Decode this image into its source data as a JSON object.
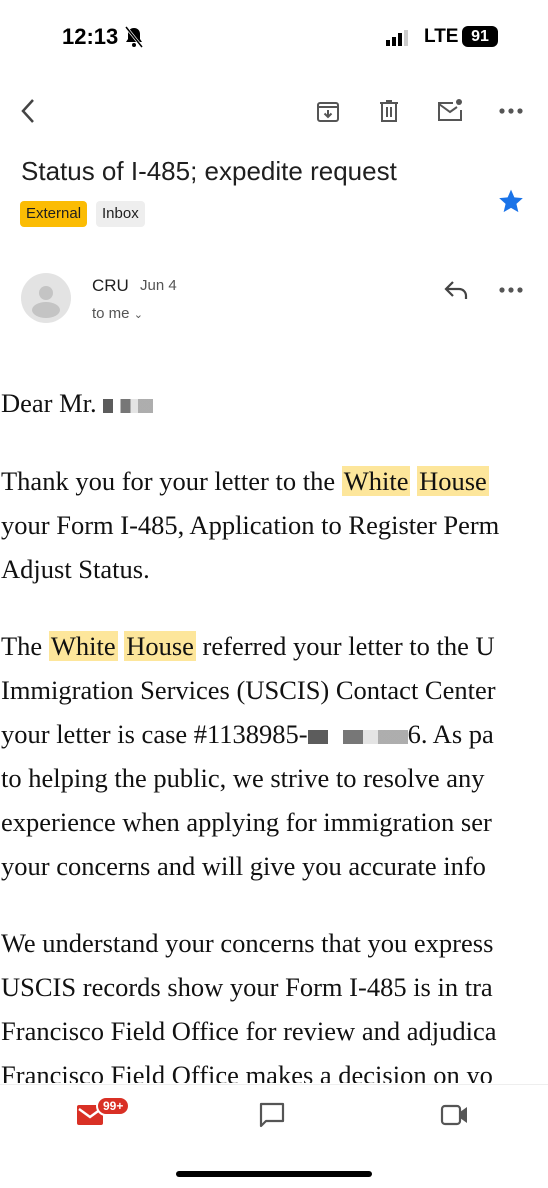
{
  "status_bar": {
    "time": "12:13",
    "network": "LTE",
    "battery": "91"
  },
  "toolbar": {
    "back": "back-icon",
    "actions": [
      "archive-icon",
      "delete-icon",
      "mark-unread-icon",
      "more-icon"
    ]
  },
  "email": {
    "subject": "Status of I-485; expedite request",
    "labels": [
      {
        "text": "External",
        "color": "#fbbc04"
      },
      {
        "text": "Inbox",
        "color": "#eeeeee"
      }
    ],
    "starred": true,
    "star_color": "#1a73e8",
    "sender": "CRU",
    "date": "Jun 4",
    "recipient": "to me",
    "body_lines": [
      [
        {
          "t": "Dear Mr. "
        },
        {
          "redact": true
        }
      ],
      [
        {
          "t": "Thank you for your letter to the "
        },
        {
          "t": "White",
          "hl": true
        },
        {
          "t": " "
        },
        {
          "t": "House",
          "hl": true
        }
      ],
      [
        {
          "t": "your Form I-485, Application to Register Perm"
        }
      ],
      [
        {
          "t": "Adjust Status."
        }
      ],
      [
        {
          "t": "The "
        },
        {
          "t": "White",
          "hl": true
        },
        {
          "t": " "
        },
        {
          "t": "House",
          "hl": true
        },
        {
          "t": " referred your letter to the U"
        }
      ],
      [
        {
          "t": "Immigration Services (USCIS) Contact Center"
        }
      ],
      [
        {
          "t": "your letter is case #1138985-"
        },
        {
          "redact": true
        },
        {
          "t": "6. As pa"
        }
      ],
      [
        {
          "t": "to helping the public, we strive to resolve any"
        }
      ],
      [
        {
          "t": "experience when applying for immigration ser"
        }
      ],
      [
        {
          "t": "your concerns and will give you accurate info"
        }
      ],
      [
        {
          "t": "We understand your concerns that you express"
        }
      ],
      [
        {
          "t": "USCIS records show your Form I-485 is in tra"
        }
      ],
      [
        {
          "t": "Francisco Field Office for review and adjudica"
        }
      ],
      [
        {
          "t": "Francisco Field Office makes a decision on yo"
        }
      ]
    ]
  },
  "bottom_nav": {
    "mail_badge": "99+",
    "items": [
      "mail-icon",
      "chat-icon",
      "meet-icon"
    ],
    "accent": "#d93025"
  }
}
